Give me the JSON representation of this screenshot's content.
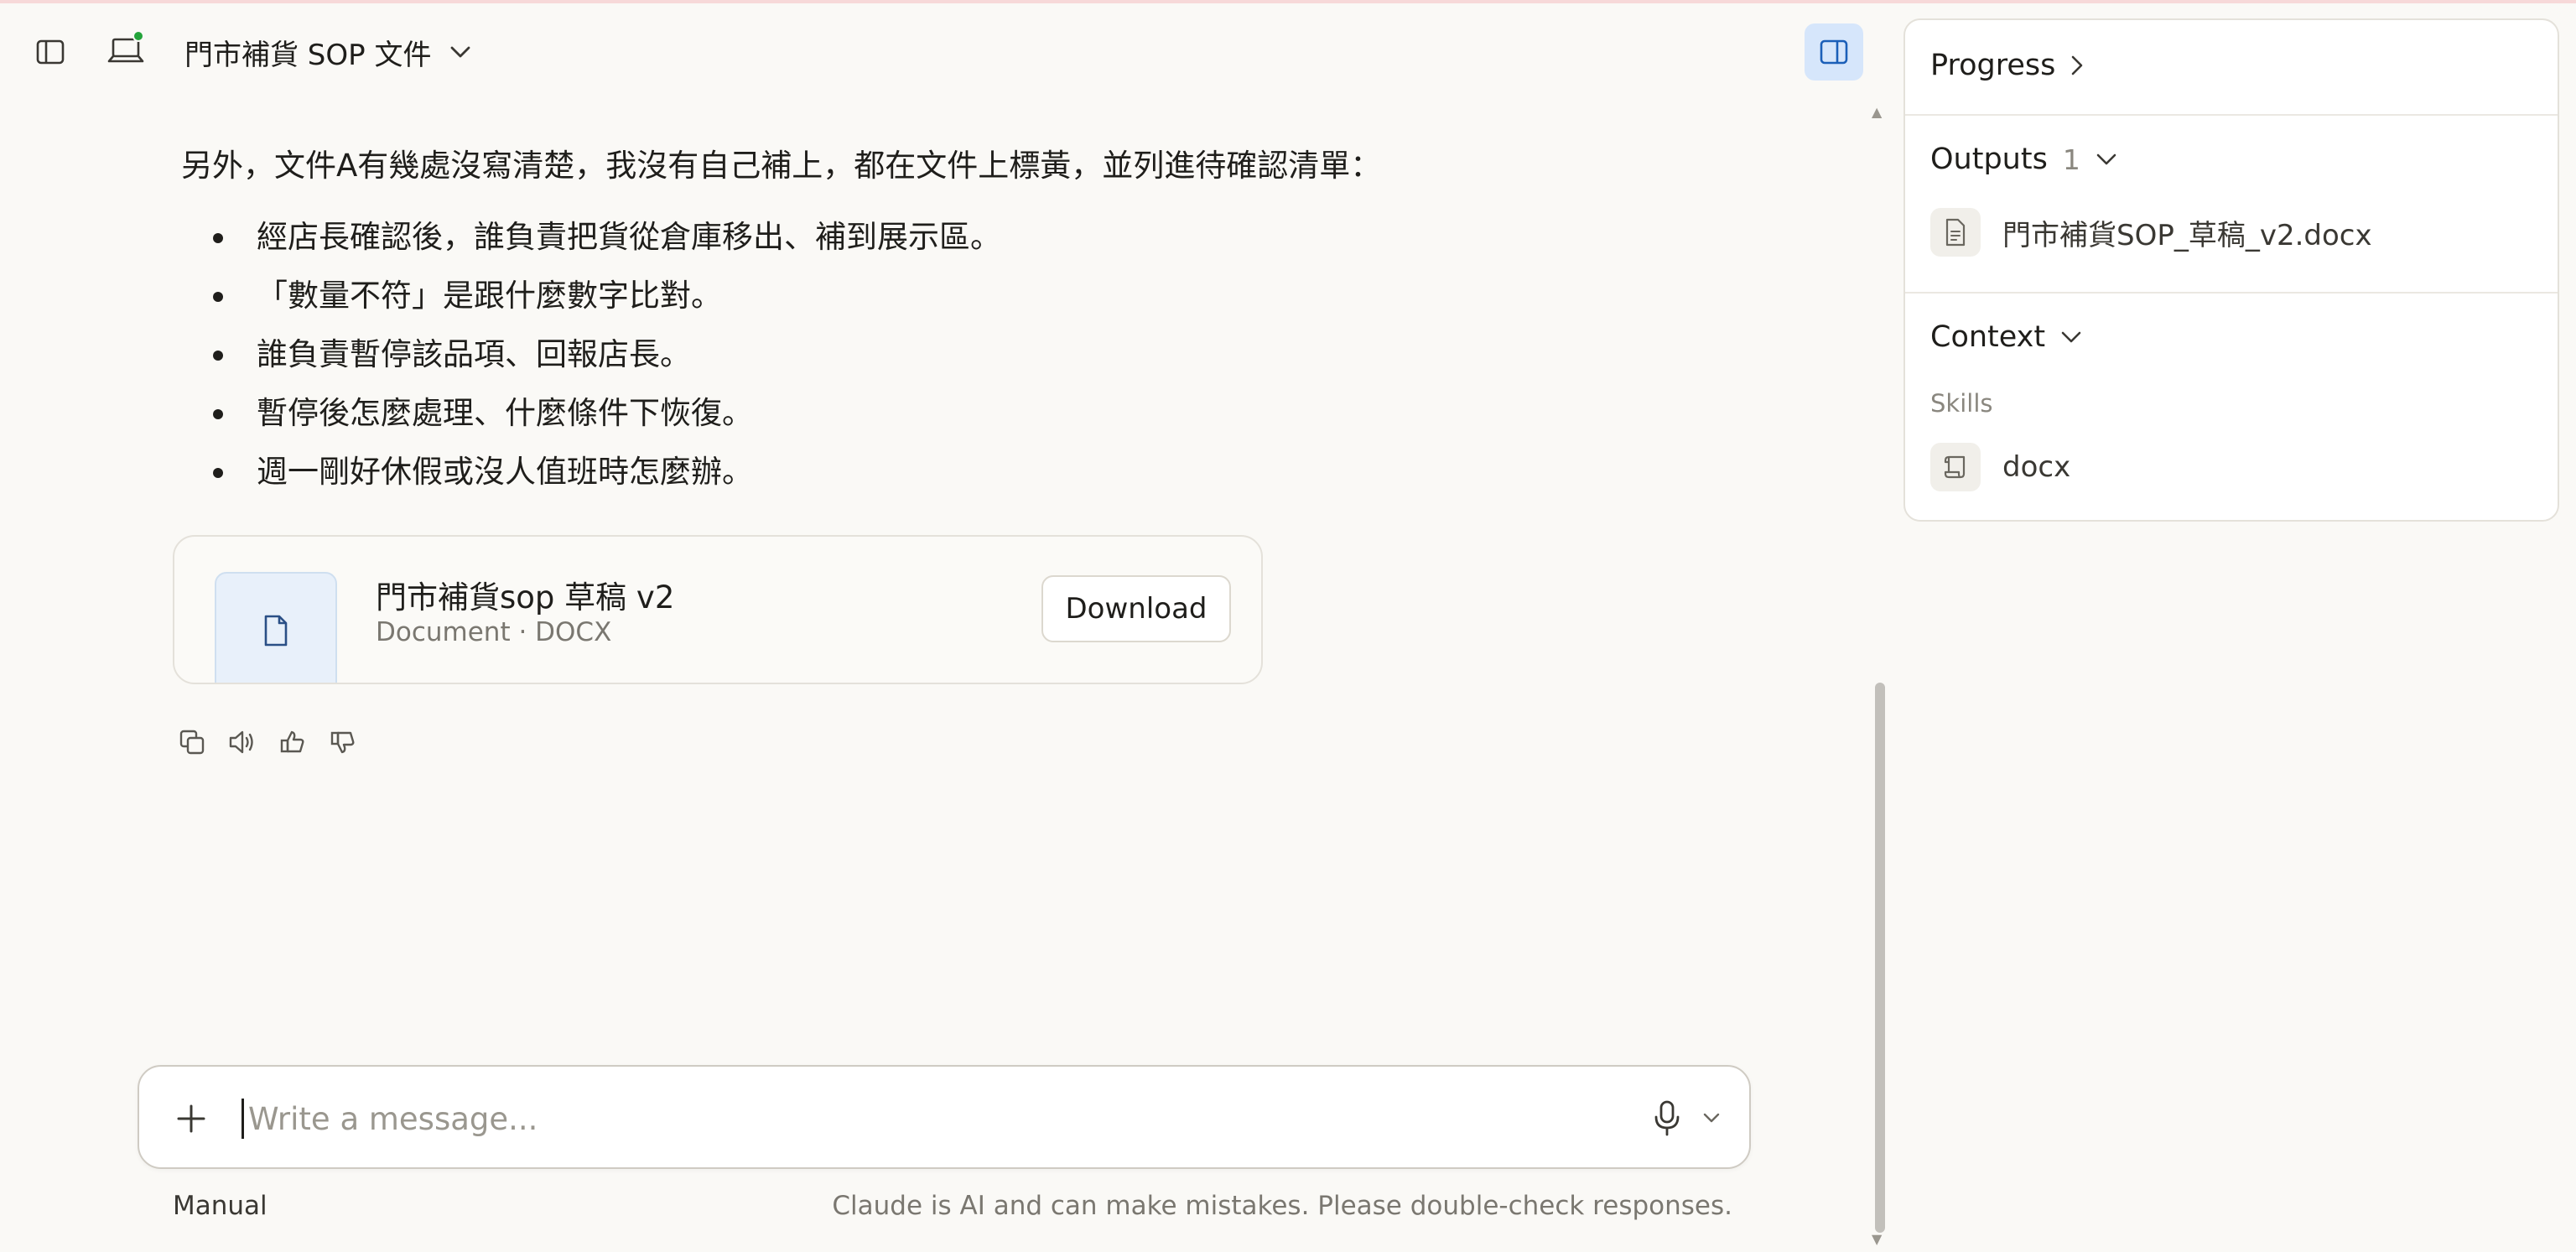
{
  "header": {
    "document_title": "門市補貨 SOP 文件"
  },
  "message": {
    "intro": "另外，文件A有幾處沒寫清楚，我沒有自己補上，都在文件上標黃，並列進待確認清單：",
    "bullets": [
      "經店長確認後，誰負責把貨從倉庫移出、補到展示區。",
      "「數量不符」是跟什麼數字比對。",
      "誰負責暫停該品項、回報店長。",
      "暫停後怎麼處理、什麼條件下恢復。",
      "週一剛好休假或沒人值班時怎麼辦。"
    ]
  },
  "file_card": {
    "name": "門市補貨sop 草稿 v2",
    "meta": "Document · DOCX",
    "download_label": "Download"
  },
  "composer": {
    "placeholder": "Write a message...",
    "mode": "Manual",
    "disclaimer": "Claude is AI and can make mistakes. Please double-check responses."
  },
  "panel": {
    "progress": {
      "label": "Progress"
    },
    "outputs": {
      "label": "Outputs",
      "count": "1",
      "items": [
        {
          "label": "門市補貨SOP_草稿_v2.docx",
          "icon": "document-icon"
        }
      ]
    },
    "context": {
      "label": "Context",
      "skills_label": "Skills",
      "skills": [
        {
          "label": "docx",
          "icon": "scroll-icon"
        }
      ]
    }
  },
  "colors": {
    "background": "#faf9f6",
    "accent_toggle": "#d6e6fb",
    "online_dot": "#23a33a"
  }
}
